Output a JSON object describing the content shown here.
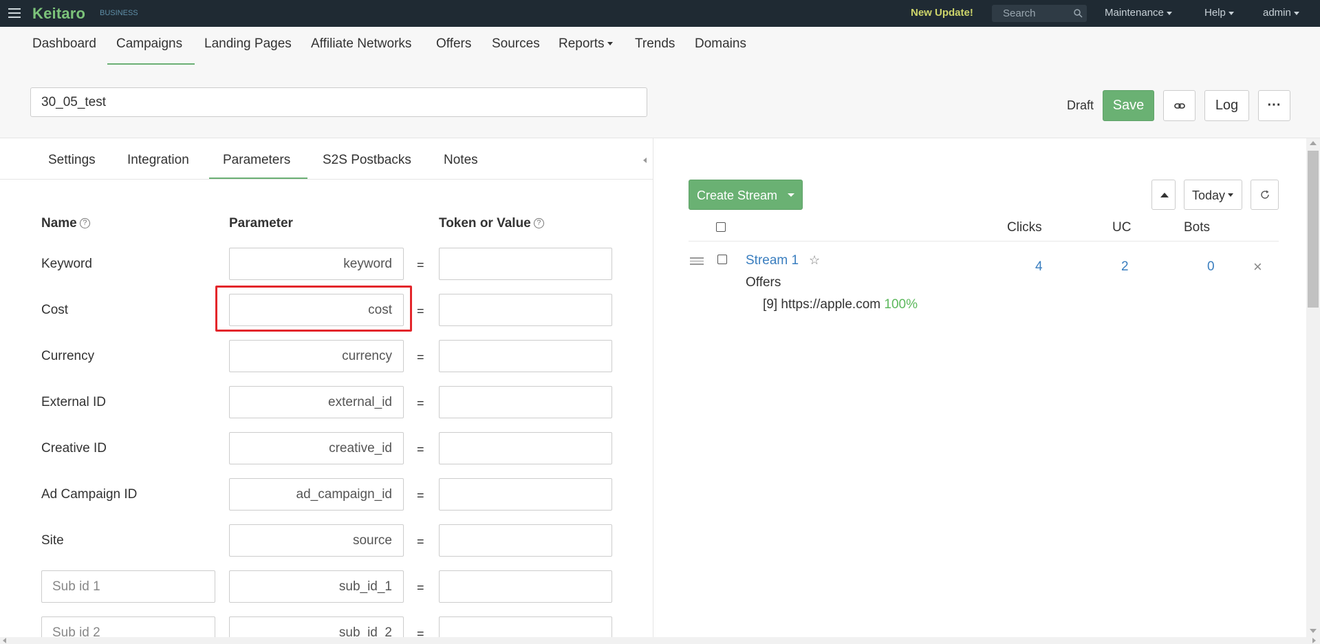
{
  "topbar": {
    "logo": "Keitaro",
    "logo_sub": "BUSINESS",
    "new_update": "New Update!",
    "search_placeholder": "Search",
    "maintenance": "Maintenance",
    "help": "Help",
    "user": "admin"
  },
  "nav": {
    "items": [
      "Dashboard",
      "Campaigns",
      "Landing Pages",
      "Affiliate Networks",
      "Offers",
      "Sources",
      "Reports",
      "Trends",
      "Domains"
    ],
    "active": "Campaigns"
  },
  "campaign": {
    "name": "30_05_test",
    "status": "Draft",
    "save_label": "Save",
    "log_label": "Log",
    "more_label": "···"
  },
  "tabs": {
    "items": [
      "Settings",
      "Integration",
      "Parameters",
      "S2S Postbacks",
      "Notes"
    ],
    "active": "Parameters"
  },
  "parameters": {
    "headers": {
      "name": "Name",
      "parameter": "Parameter",
      "token": "Token or Value"
    },
    "eq": "=",
    "rows": [
      {
        "name": "Keyword",
        "parameter": "keyword",
        "token": ""
      },
      {
        "name": "Cost",
        "parameter": "cost",
        "token": ""
      },
      {
        "name": "Currency",
        "parameter": "currency",
        "token": ""
      },
      {
        "name": "External ID",
        "parameter": "external_id",
        "token": ""
      },
      {
        "name": "Creative ID",
        "parameter": "creative_id",
        "token": ""
      },
      {
        "name": "Ad Campaign ID",
        "parameter": "ad_campaign_id",
        "token": ""
      },
      {
        "name": "Site",
        "parameter": "source",
        "token": ""
      },
      {
        "name_placeholder": "Sub id 1",
        "parameter": "sub_id_1",
        "token": ""
      },
      {
        "name_placeholder": "Sub id 2",
        "parameter": "sub_id_2",
        "token": ""
      }
    ]
  },
  "streams": {
    "create_label": "Create Stream",
    "period": "Today",
    "headers": {
      "clicks": "Clicks",
      "uc": "UC",
      "bots": "Bots"
    },
    "items": [
      {
        "name": "Stream 1",
        "clicks": "4",
        "uc": "2",
        "bots": "0",
        "offers_label": "Offers",
        "offer_id": "[9]",
        "offer_url": "https://apple.com",
        "offer_share": "100%"
      }
    ]
  },
  "colors": {
    "topbar_bg": "#1f2a33",
    "brand_green": "#7cc37a",
    "button_green": "#6ab173",
    "link_blue": "#3a7ebf",
    "highlight_red": "#e3262b"
  }
}
